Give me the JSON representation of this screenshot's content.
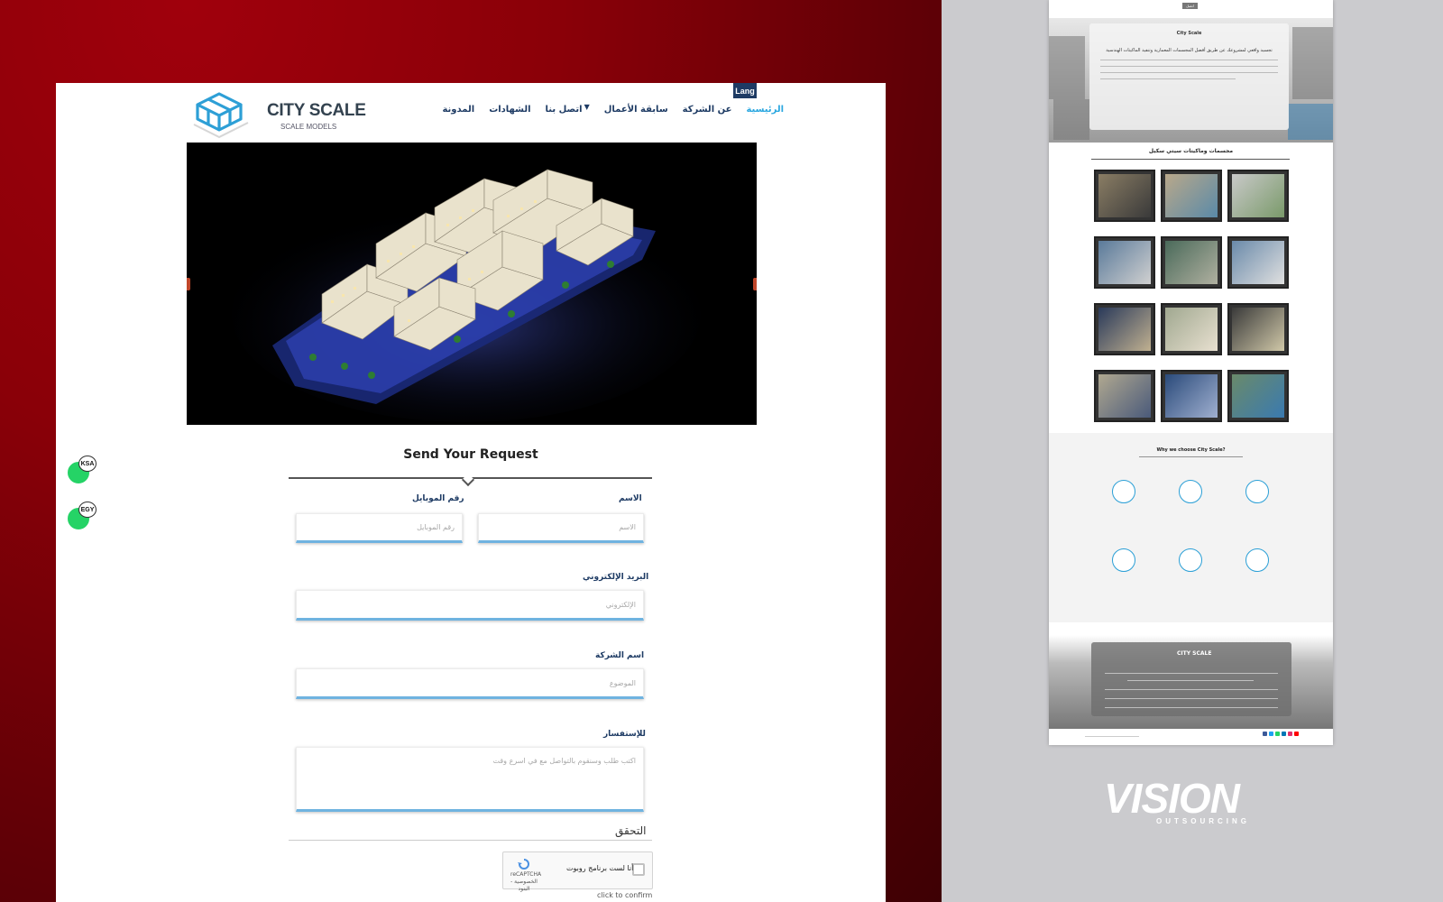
{
  "header": {
    "logo_word": "CITY SCALE",
    "logo_sub": "SCALE MODELS",
    "lang_label": "Lang",
    "nav": [
      {
        "label": "الرئيسية",
        "active": true
      },
      {
        "label": "عن الشركة",
        "active": false
      },
      {
        "label": "سابقة الأعمال",
        "active": false,
        "has_dropdown": true
      },
      {
        "label": "اتصل بنا",
        "active": false
      },
      {
        "label": "الشهادات",
        "active": false
      },
      {
        "label": "المدونة",
        "active": false
      }
    ]
  },
  "form": {
    "title": "Send Your Request",
    "name_label": "الاسم",
    "name_placeholder": "الاسم",
    "mobile_label": "رقم الموبايل",
    "mobile_placeholder": "رقم الموبايل",
    "email_label": "البريد الإلكتروني",
    "email_placeholder": "الإلكتروني",
    "company_label": "اسم الشركة",
    "company_placeholder": "الموضوع",
    "inquiry_label": "للإستفسار",
    "inquiry_placeholder": "اكتب طلب وسنقوم بالتواصل مع في اسرع وقت",
    "verify_label": "التحقق",
    "captcha_text": "أنا لست برنامج روبوت",
    "captcha_brand": "reCAPTCHA",
    "captcha_terms": "الخصوصية - البنود",
    "confirm_text": "click to confirm"
  },
  "whatsapp": [
    {
      "badge": "KSA"
    },
    {
      "badge": "EGY"
    }
  ],
  "preview": {
    "top_button": "اتصل",
    "hero_title": "City Scale",
    "hero_subtitle": "تجسيد واقعي لمشروعك عن طريق أفضل المجسمات المعمارية وتنفيذ الماكيتات الهندسية",
    "gallery_title": "مجسمات وماكيتات سيتي سكيل",
    "why_title": "Why we choose City Scale?",
    "footer_brand": "CITY SCALE"
  },
  "brand_mark": {
    "word": "VISION",
    "sub": "OUTSOURCING"
  },
  "colors": {
    "accent": "#2aa7e0",
    "nav_dark": "#1e3b64",
    "field_underline": "#6fb3e0",
    "whatsapp": "#25d366"
  }
}
